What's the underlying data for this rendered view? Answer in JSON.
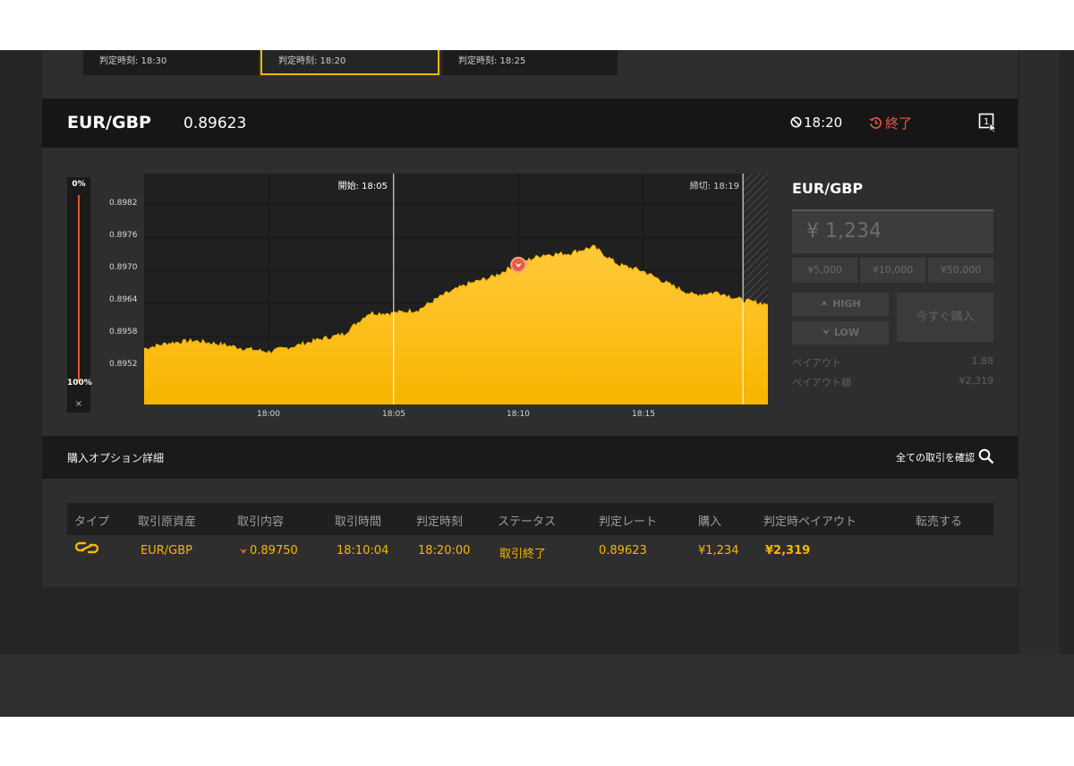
{
  "tabs": [
    {
      "label": "判定時刻: 18:30",
      "active": false
    },
    {
      "label": "判定時刻: 18:20",
      "active": true
    },
    {
      "label": "判定時刻: 18:25",
      "active": false
    }
  ],
  "header": {
    "pair": "EUR/GBP",
    "rate": "0.89623",
    "clock": "18:20",
    "status": "終了",
    "status_color": "#ea5a3e",
    "rule_icon_text": "1"
  },
  "gauge": {
    "top": "0%",
    "bottom": "100%",
    "close": "×"
  },
  "chart_data": {
    "type": "area",
    "y_ticks": [
      "0.8982",
      "0.8976",
      "0.8970",
      "0.8964",
      "0.8958",
      "0.8952"
    ],
    "x_ticks": [
      "18:00",
      "18:05",
      "18:10",
      "18:15"
    ],
    "x_range": [
      "17:55",
      "18:20"
    ],
    "ylim": [
      0.89457,
      0.89875
    ],
    "start_label": "開始: 18:05",
    "close_label": "締切: 18:19",
    "series": [
      {
        "color": "#f5b800",
        "x": [
          "17:55",
          "17:56",
          "17:57",
          "17:58",
          "17:59",
          "18:00",
          "18:01",
          "18:02",
          "18:03",
          "18:04",
          "18:05",
          "18:06",
          "18:07",
          "18:08",
          "18:09",
          "18:10",
          "18:11",
          "18:12",
          "18:13",
          "18:14",
          "18:15",
          "18:16",
          "18:17",
          "18:18",
          "18:19",
          "18:20"
        ],
        "values": [
          0.89558,
          0.89568,
          0.89572,
          0.89566,
          0.89558,
          0.89552,
          0.89562,
          0.89574,
          0.89584,
          0.89622,
          0.89622,
          0.89628,
          0.89655,
          0.89675,
          0.89688,
          0.89712,
          0.89728,
          0.8973,
          0.89742,
          0.8971,
          0.89698,
          0.89675,
          0.89655,
          0.8966,
          0.89645,
          0.89638
        ]
      }
    ],
    "entry_marker": {
      "x": "18:10",
      "value": 0.8971
    }
  },
  "trade_panel": {
    "title": "EUR/GBP",
    "amount": "¥ 1,234",
    "quick_amounts": [
      "¥5,000",
      "¥10,000",
      "¥50,000"
    ],
    "high_label": "HIGH",
    "low_label": "LOW",
    "buy_now": "今すぐ購入",
    "payout_label": "ペイアウト",
    "payout_value": "1.88",
    "payout_amount_label": "ペイアウト額",
    "payout_amount_value": "¥2,319"
  },
  "details": {
    "title": "購入オプション詳細",
    "view_all": "全ての取引を確認",
    "headers": [
      "タイプ",
      "取引原資産",
      "取引内容",
      "取引時間",
      "判定時刻",
      "ステータス",
      "判定レート",
      "購入",
      "判定時ペイアウト",
      "転売する"
    ],
    "row": {
      "asset": "EUR/GBP",
      "content": "0.89750",
      "trade_time": "18:10:04",
      "judge_time": "18:20:00",
      "status": "取引終了",
      "judge_rate": "0.89623",
      "purchase": "¥1,234",
      "payout": "¥2,319"
    }
  },
  "colors": {
    "accent": "#f5b800",
    "danger": "#ea5a3e",
    "background": "#252525"
  }
}
